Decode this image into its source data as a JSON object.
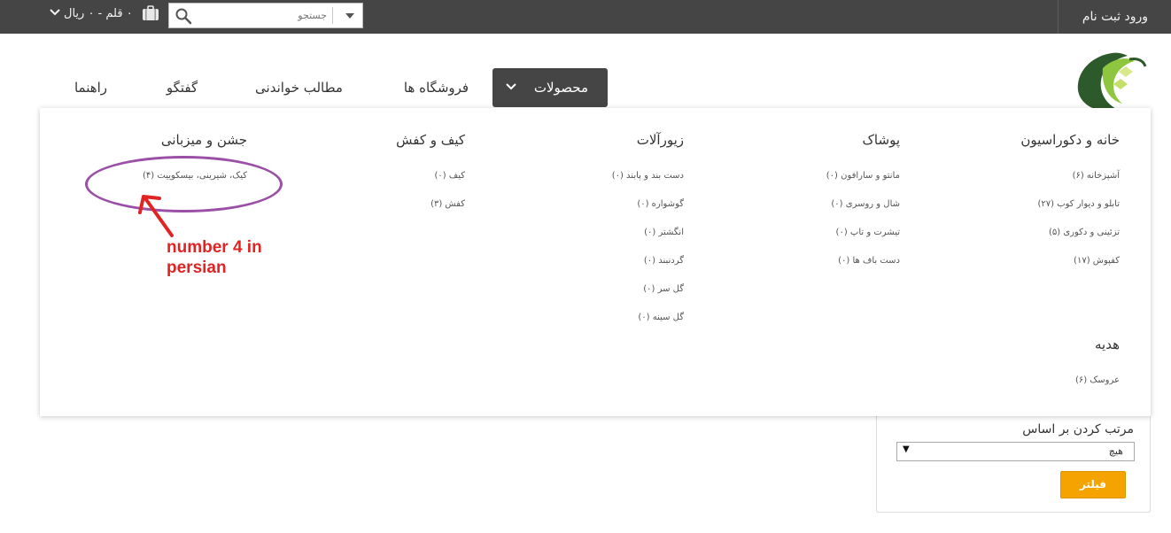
{
  "topbar": {
    "register_label": "ثبت نام",
    "login_label": "ورود",
    "search_placeholder": "جستجو",
    "cart_summary": "۰ قلم - ۰ ریال"
  },
  "nav": {
    "products": "محصولات",
    "stores": "فروشگاه ها",
    "articles": "مطالب خواندنی",
    "chat": "گفتگو",
    "help": "راهنما"
  },
  "mega_menu": {
    "columns": [
      {
        "title": "خانه و دکوراسیون",
        "items": [
          "آشپزخانه (۶)",
          "تابلو و دیوار کوب (۲۷)",
          "تزئینی و دکوری (۵)",
          "کفپوش (۱۷)"
        ]
      },
      {
        "title": "پوشاک",
        "items": [
          "مانتو و سارافون (۰)",
          "شال و روسری (۰)",
          "تیشرت و تاپ (۰)",
          "دست باف ها (۰)"
        ]
      },
      {
        "title": "زیورآلات",
        "items": [
          "دست بند و پابند (۰)",
          "گوشواره (۰)",
          "انگشتر (۰)",
          "گردنبند (۰)",
          "گل سر (۰)",
          "گل سینه (۰)"
        ]
      },
      {
        "title": "کیف و کفش",
        "items": [
          "کیف (۰)",
          "کفش (۳)"
        ]
      },
      {
        "title": "جشن و میزبانی",
        "items": [
          "کیک، شیرینی، بیسکوییت (۴)"
        ]
      },
      {
        "title": "هدیه",
        "items": [
          "عروسک (۶)"
        ]
      }
    ]
  },
  "filter": {
    "sort_label": "مرتب کردن بر اساس",
    "sort_value": "هیچ",
    "sort_arrow": "▼",
    "button_label": "فیلتر"
  },
  "annotation": {
    "text": "number 4 in\npersian",
    "color": "#e02424",
    "ellipse_color": "#9b4fa6"
  },
  "colors": {
    "topbar_bg": "#454545",
    "active_nav_bg": "#454545",
    "filter_button": "#f5a300"
  }
}
